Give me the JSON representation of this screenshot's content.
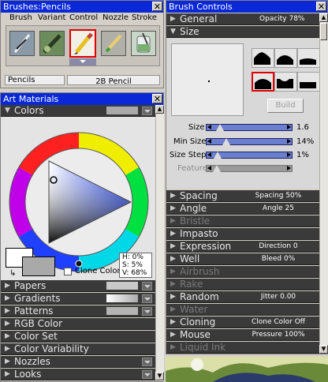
{
  "brushes_palette": {
    "title": "Brushes:Pencils",
    "menu": [
      "Brush",
      "Variant",
      "Control",
      "Nozzle",
      "Stroke"
    ],
    "category": "Pencils",
    "variant": "2B Pencil"
  },
  "art_materials": {
    "title": "Art Materials",
    "colors_label": "Colors",
    "clone_color_label": "Clone Color",
    "hsv": {
      "h": "H:  0%",
      "s": "S:  5%",
      "v": "V: 68%"
    },
    "sections": [
      {
        "label": "Papers"
      },
      {
        "label": "Gradients"
      },
      {
        "label": "Patterns"
      },
      {
        "label": "RGB Color"
      },
      {
        "label": "Color Set"
      },
      {
        "label": "Color Variability"
      },
      {
        "label": "Nozzles"
      },
      {
        "label": "Looks"
      }
    ]
  },
  "brush_controls": {
    "title": "Brush Controls",
    "general": {
      "label": "General",
      "value": "Opacity 78%"
    },
    "size_label": "Size",
    "build_label": "Build",
    "sliders": [
      {
        "label": "Size",
        "value": "1.6",
        "fraction": 0.05
      },
      {
        "label": "Min Size",
        "value": "14%",
        "fraction": 0.14
      },
      {
        "label": "Size Step",
        "value": "1%",
        "fraction": 0.01
      },
      {
        "label": "Feature",
        "value": "",
        "fraction": 0.0
      }
    ],
    "sections": [
      {
        "label": "Spacing",
        "value": "Spacing 50%"
      },
      {
        "label": "Angle",
        "value": "Angle 25"
      },
      {
        "label": "Bristle",
        "value": ""
      },
      {
        "label": "Impasto",
        "value": ""
      },
      {
        "label": "Expression",
        "value": "Direction 0"
      },
      {
        "label": "Well",
        "value": "Bleed 0%"
      },
      {
        "label": "Airbrush",
        "value": ""
      },
      {
        "label": "Rake",
        "value": ""
      },
      {
        "label": "Random",
        "value": "Jitter 0.00"
      },
      {
        "label": "Water",
        "value": ""
      },
      {
        "label": "Cloning",
        "value": "Clone Color Off"
      },
      {
        "label": "Mouse",
        "value": "Pressure 100%"
      },
      {
        "label": "Liquid Ink",
        "value": ""
      }
    ]
  },
  "colors": {
    "accent": "#0a28d6",
    "selection": "#e00000",
    "panel_dark": "#3a3a3a"
  }
}
